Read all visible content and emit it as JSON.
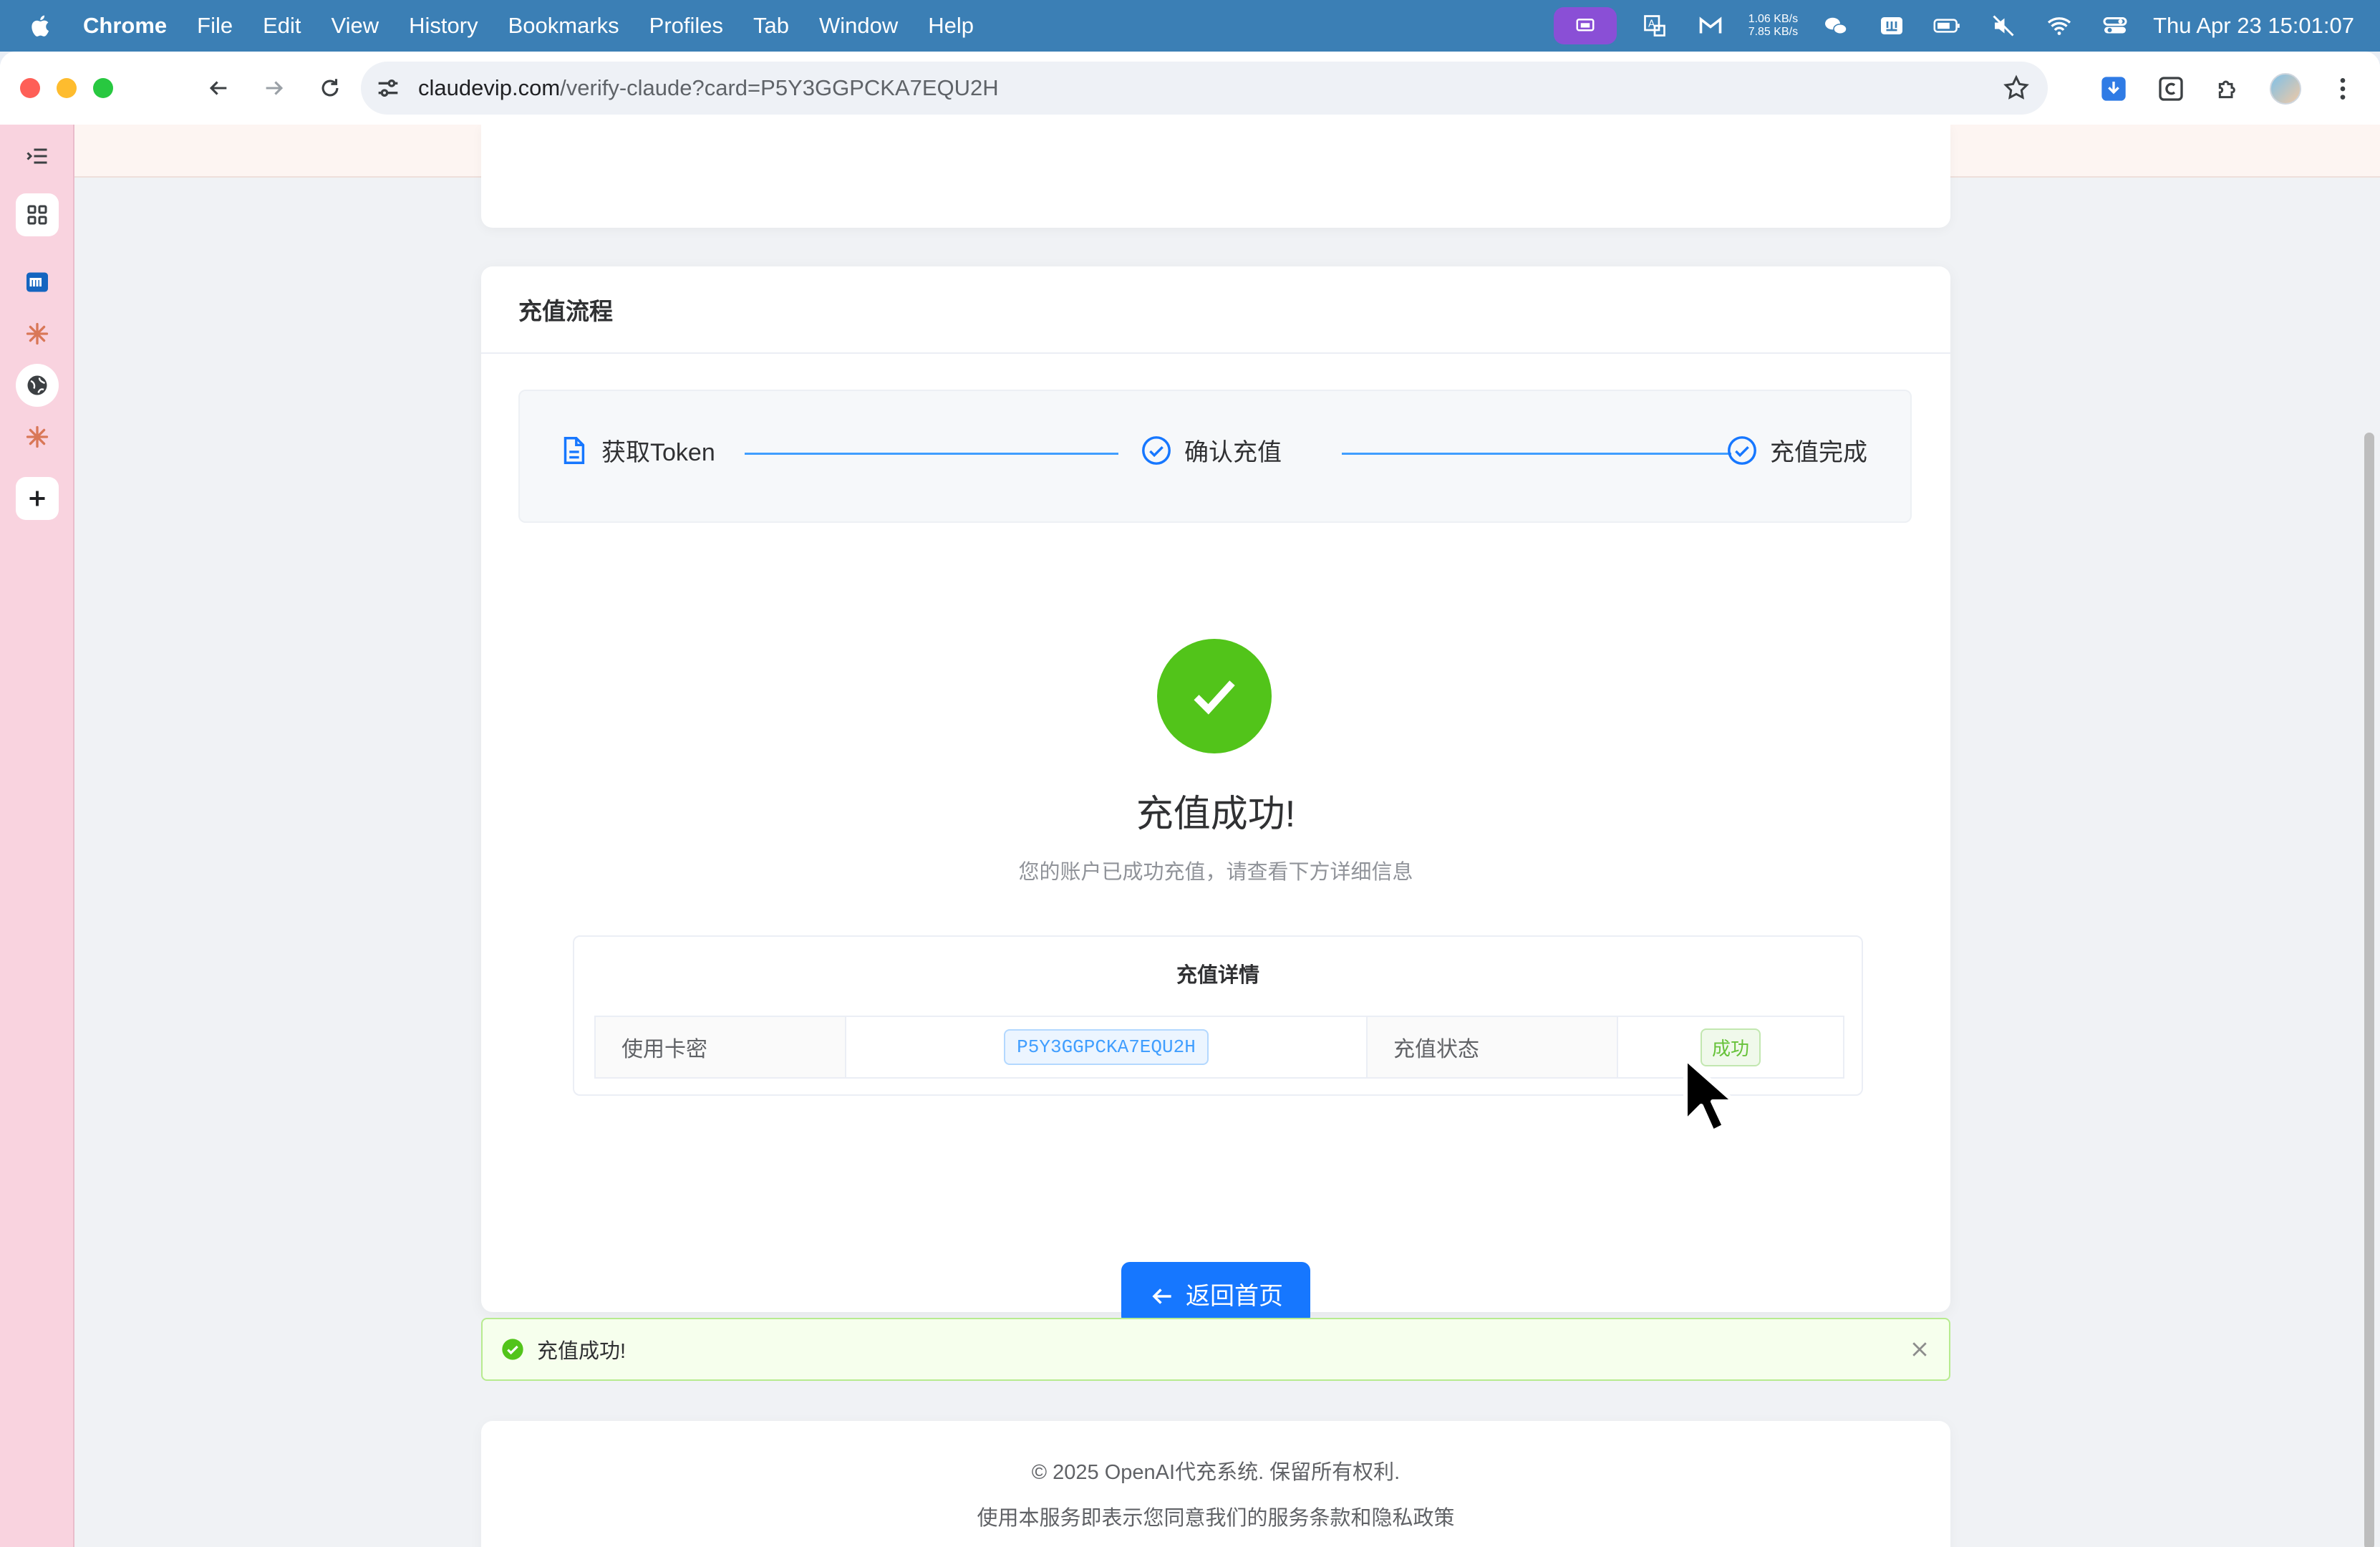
{
  "menubar": {
    "app_name": "Chrome",
    "menus": [
      "File",
      "Edit",
      "View",
      "History",
      "Bookmarks",
      "Profiles",
      "Tab",
      "Window",
      "Help"
    ],
    "net_up": "1.06 KB/s",
    "net_down": "7.85 KB/s",
    "datetime": "Thu Apr 23  15:01:07",
    "tray_icons": [
      "screen-mirror-icon",
      "translate-icon",
      "gmail-icon",
      "wechat-icon",
      "input-method-icon",
      "battery-icon",
      "mute-icon",
      "wifi-icon",
      "control-center-icon"
    ]
  },
  "browser": {
    "url_host": "claudevip.com",
    "url_path": "/verify-claude?card=P5Y3GGPCKA7EQU2H"
  },
  "sidebar": {
    "items": [
      "collapse-icon",
      "apps-grid-icon",
      "m-app-icon",
      "claude-icon",
      "globe-icon",
      "claude-icon",
      "add-icon"
    ]
  },
  "page": {
    "section_title": "充值流程",
    "steps": [
      "获取Token",
      "确认充值",
      "充值完成"
    ],
    "success_title": "充值成功!",
    "success_subtitle": "您的账户已成功充值，请查看下方详细信息",
    "details": {
      "title": "充值详情",
      "card_label": "使用卡密",
      "card_value": "P5Y3GGPCKA7EQU2H",
      "status_label": "充值状态",
      "status_value": "成功"
    },
    "home_button": "返回首页",
    "alert_text": "充值成功!",
    "footer": {
      "copyright": "© 2025 OpenAI代充系统. 保留所有权利.",
      "terms": "使用本服务即表示您同意我们的服务条款和隐私政策"
    }
  },
  "colors": {
    "accent": "#1677ff",
    "success": "#52c41a",
    "step_line": "#409eff",
    "sidebar_bg": "#f9d3df",
    "menubar_bg": "#3b7fb5"
  }
}
